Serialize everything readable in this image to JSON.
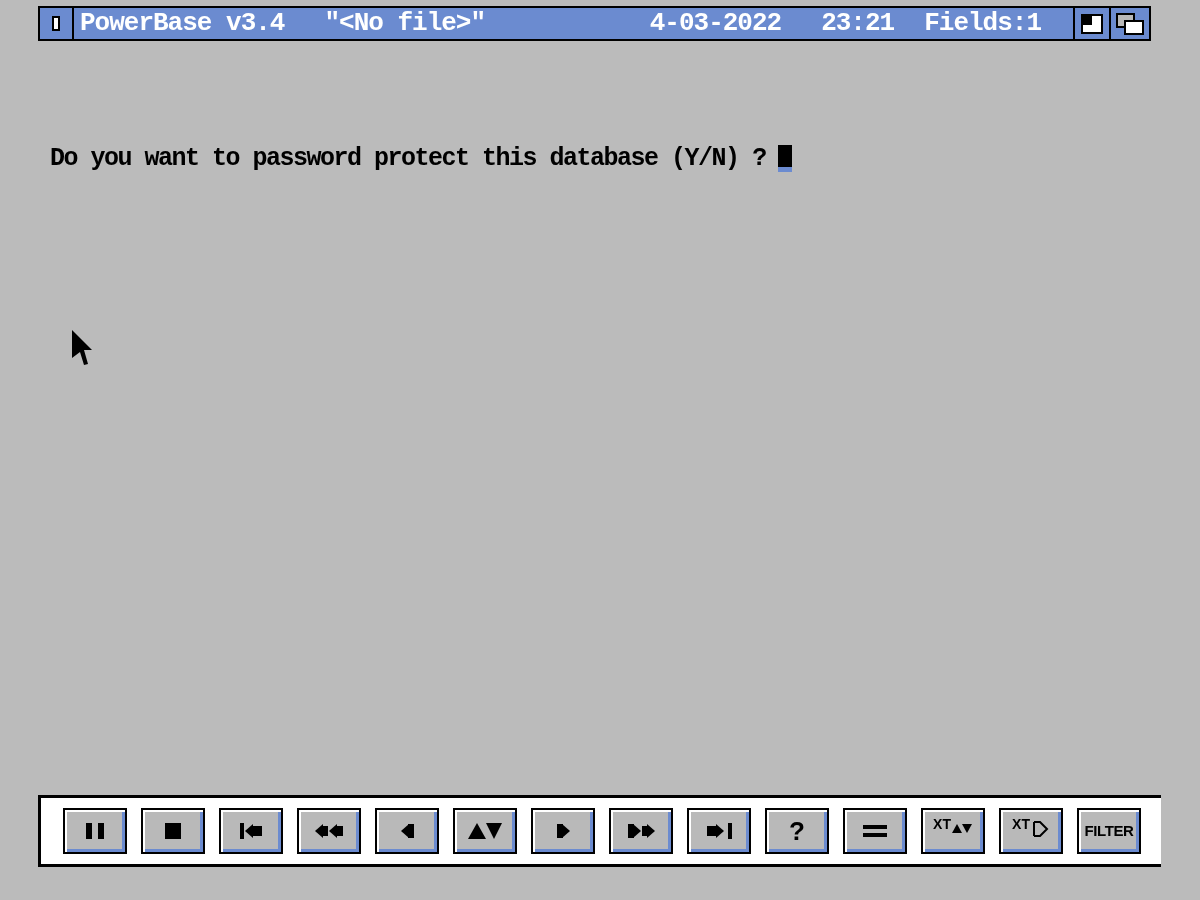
{
  "window": {
    "title": "PowerBase v3.4",
    "file": "\"<No file>\"",
    "date": "4-03-2022",
    "time": "23:21",
    "fields": "Fields:1"
  },
  "prompt": {
    "text": "Do you want to password protect this database (Y/N) ?"
  },
  "toolbar": [
    {
      "kind": "pause"
    },
    {
      "kind": "stop"
    },
    {
      "kind": "first"
    },
    {
      "kind": "rewind"
    },
    {
      "kind": "back"
    },
    {
      "kind": "sort"
    },
    {
      "kind": "forward"
    },
    {
      "kind": "fastforward"
    },
    {
      "kind": "last"
    },
    {
      "kind": "text",
      "label": "?"
    },
    {
      "kind": "equals"
    },
    {
      "kind": "xt-sort",
      "label": "XT"
    },
    {
      "kind": "xt-gate",
      "label": "XT"
    },
    {
      "kind": "text",
      "label": "FILTER"
    }
  ]
}
